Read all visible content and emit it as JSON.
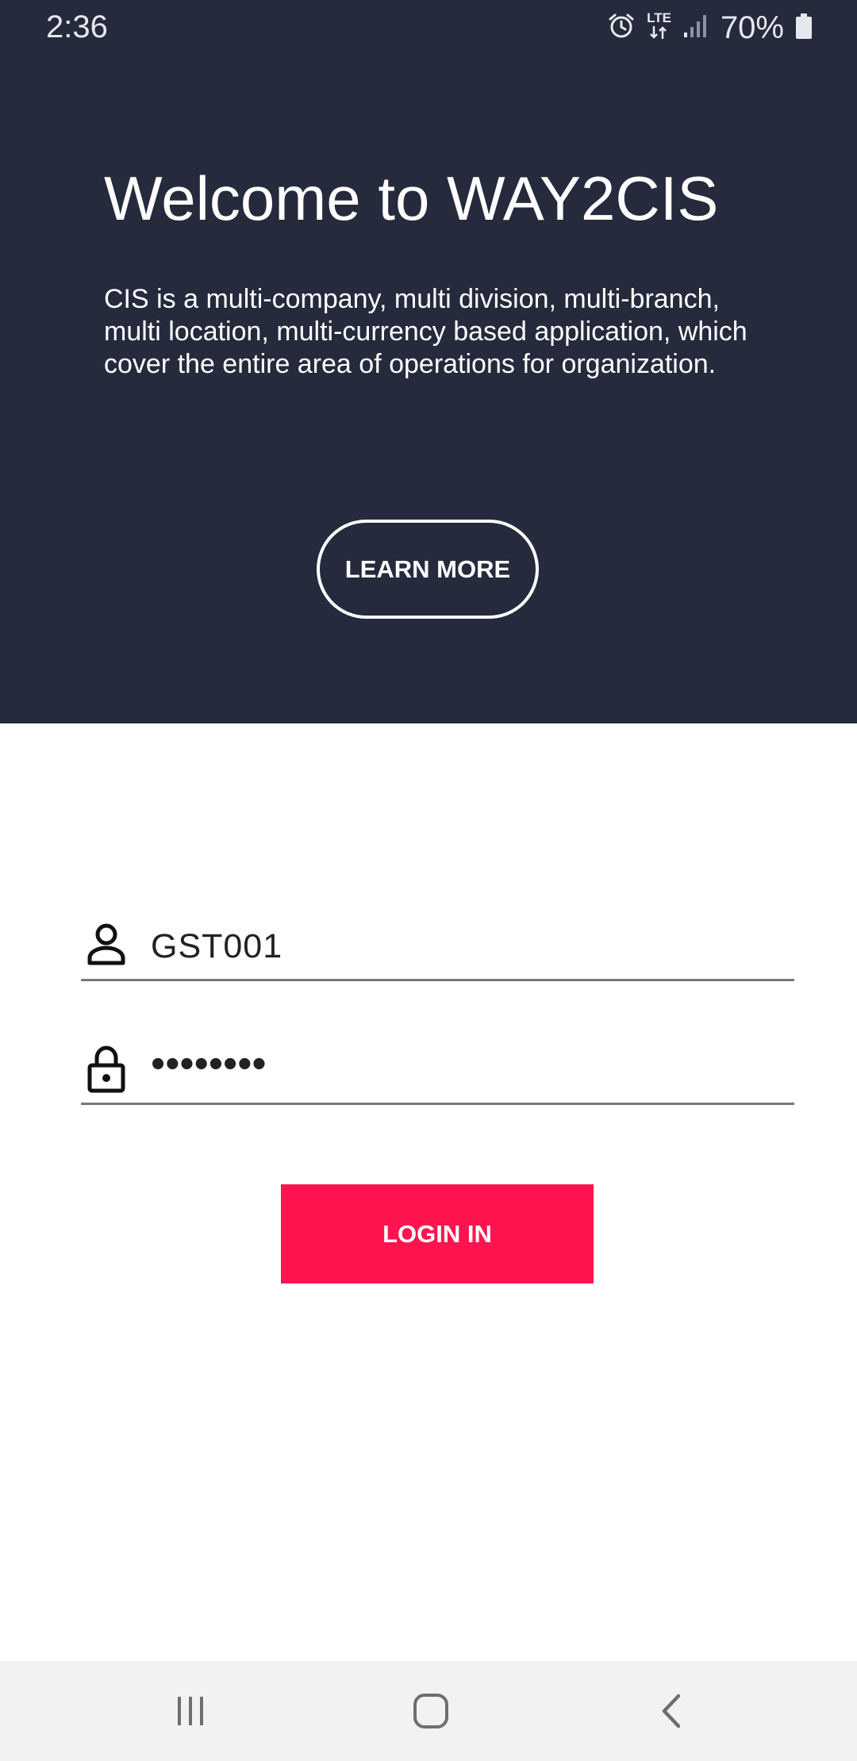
{
  "status_bar": {
    "time": "2:36",
    "network": "LTE",
    "battery": "70%",
    "icons": [
      "alarm-icon",
      "lte-icon",
      "signal-icon",
      "battery-icon"
    ]
  },
  "hero": {
    "title": "Welcome to WAY2CIS",
    "description": "CIS is a multi-company, multi division, multi-branch, multi location, multi-currency based application, which cover the entire area of operations for organization.",
    "learn_more_label": "LEARN MORE",
    "background_color": "#252a3c"
  },
  "login_form": {
    "username": {
      "icon": "person-icon",
      "value": "GST001"
    },
    "password": {
      "icon": "lock-icon",
      "value": "••••••••"
    },
    "submit_label": "LOGIN IN",
    "accent_color": "#ff1450"
  },
  "nav_bar": {
    "icons": [
      "recent-apps-icon",
      "home-icon",
      "back-icon"
    ]
  }
}
